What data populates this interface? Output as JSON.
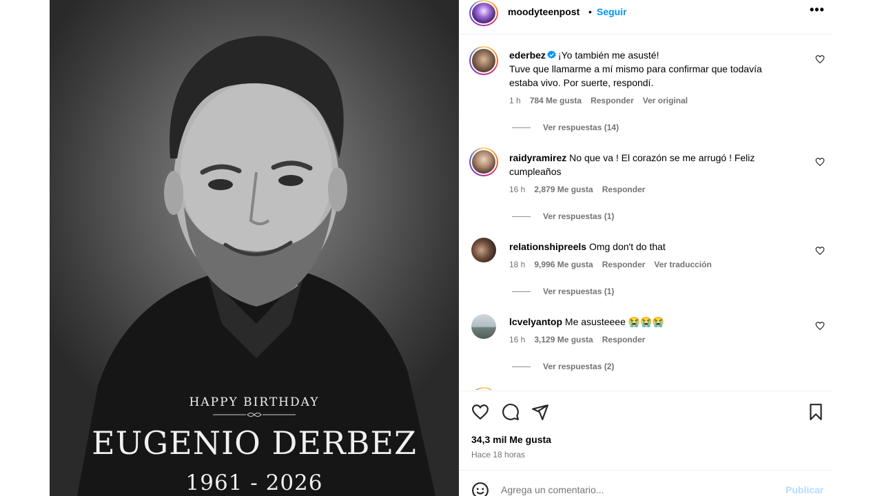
{
  "photo": {
    "caption_top": "HAPPY BIRTHDAY",
    "caption_name": "EUGENIO DERBEZ",
    "caption_years": "1961 - 2026"
  },
  "header": {
    "username": "moodyteenpost",
    "separator": "•",
    "follow_label": "Seguir",
    "more_icon": "more-horizontal-icon"
  },
  "comments": [
    {
      "username": "ederbez",
      "verified": true,
      "text_line1": "¡Yo también me asusté!",
      "text_rest": "Tuve que llamarme a mí mismo para confirmar que todavía estaba vivo. Por suerte, respondí.",
      "time": "1 h",
      "likes": "784 Me gusta",
      "reply": "Responder",
      "extra": "Ver original",
      "replies": "Ver respuestas (14)"
    },
    {
      "username": "raidyramirez",
      "text": "No que va ! El corazón se me arrugó ! Feliz cumpleaños",
      "time": "16 h",
      "likes": "2,879 Me gusta",
      "reply": "Responder",
      "replies": "Ver respuestas (1)"
    },
    {
      "username": "relationshipreels",
      "text": "Omg don't do that",
      "time": "18 h",
      "likes": "9,996 Me gusta",
      "reply": "Responder",
      "extra": "Ver traducción",
      "replies": "Ver respuestas (1)"
    },
    {
      "username": "lcvelyantop",
      "text": "Me asusteeee 😭😭😭",
      "time": "16 h",
      "likes": "3,129 Me gusta",
      "reply": "Responder",
      "replies": "Ver respuestas (2)"
    }
  ],
  "actions": {
    "likes": "34,3 mil Me gusta",
    "time": "Hace 18 horas"
  },
  "add_comment": {
    "placeholder": "Agrega un comentario...",
    "post_label": "Publicar"
  },
  "colors": {
    "accent": "#0095f6",
    "muted": "#737373",
    "post_disabled": "#b3dbff"
  }
}
